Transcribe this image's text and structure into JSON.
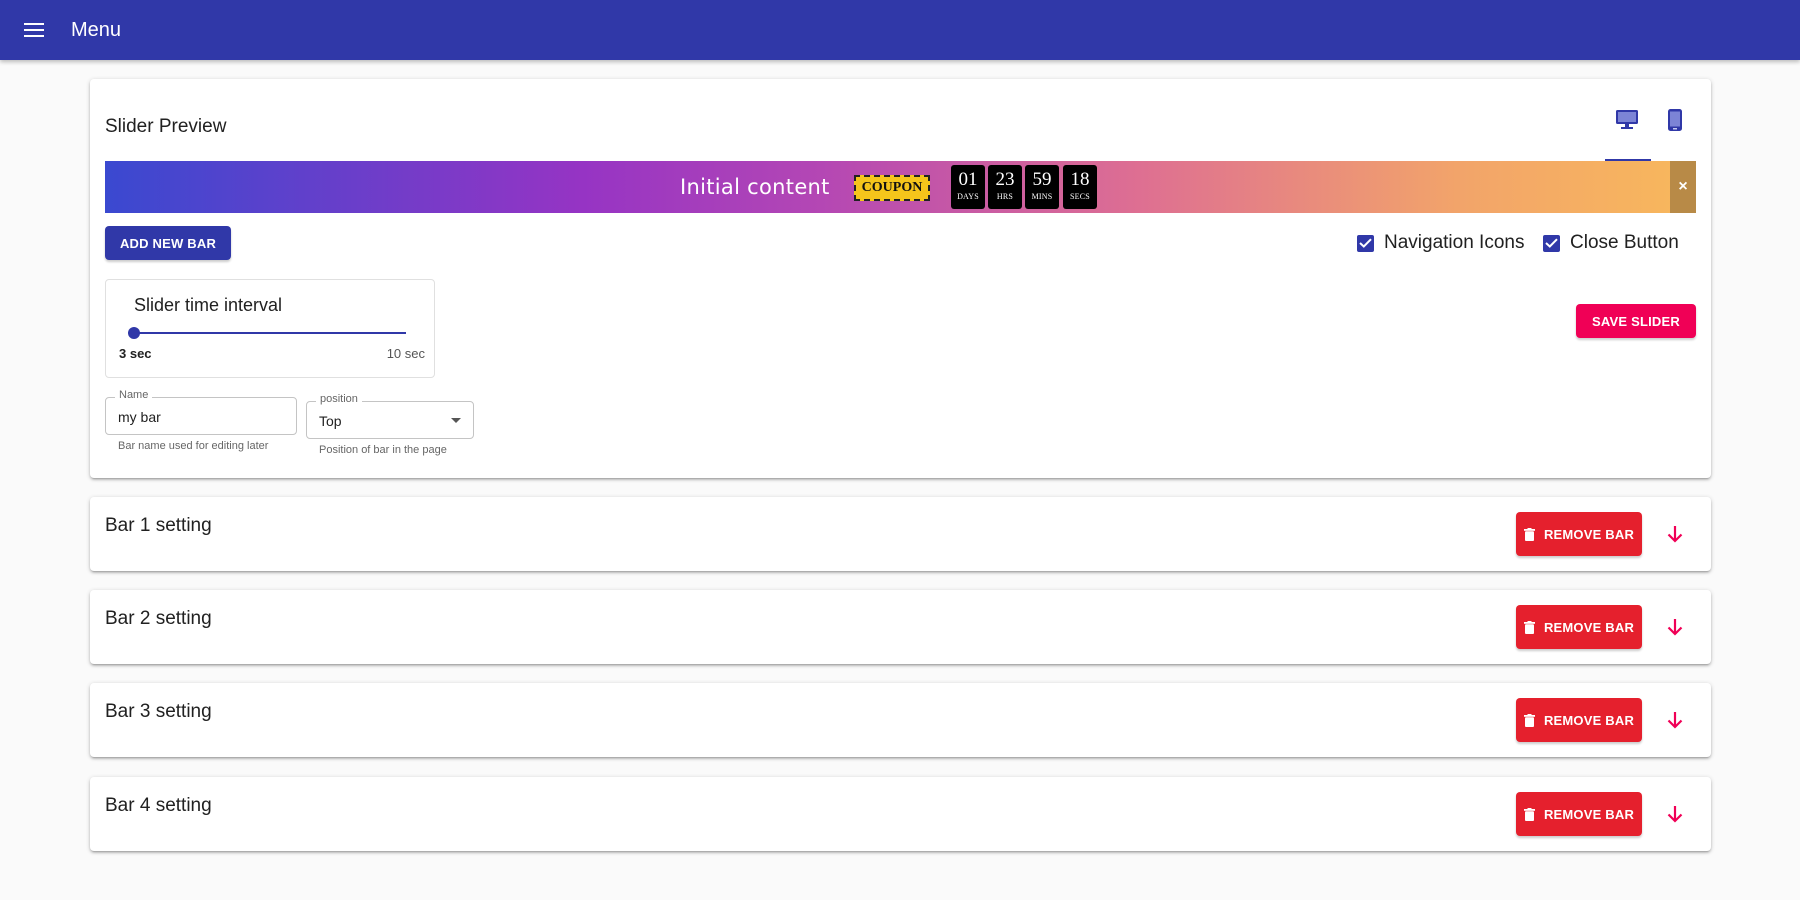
{
  "appbar": {
    "title": "Menu",
    "menu_icon": "hamburger-menu-icon",
    "background": "#3038a8"
  },
  "preview": {
    "title": "Slider Preview",
    "device_tabs": [
      {
        "name": "desktop",
        "icon": "desktop-monitor-icon",
        "selected": true
      },
      {
        "name": "mobile",
        "icon": "mobile-phone-icon",
        "selected": false
      }
    ],
    "promo_bar": {
      "text": "Initial content",
      "coupon_label": "COUPON",
      "countdown": [
        {
          "value": "01",
          "label": "DAYS"
        },
        {
          "value": "23",
          "label": "HRS"
        },
        {
          "value": "59",
          "label": "MINS"
        },
        {
          "value": "18",
          "label": "SECS"
        }
      ],
      "close_glyph": "×"
    },
    "add_button_label": "ADD NEW BAR",
    "options": {
      "navigation_icons": {
        "label": "Navigation Icons",
        "checked": true
      },
      "close_button": {
        "label": "Close Button",
        "checked": true
      }
    },
    "save_button_label": "SAVE SLIDER",
    "interval": {
      "title": "Slider time interval",
      "min_label": "3 sec",
      "max_label": "10 sec",
      "value_fraction": 0
    },
    "name_field": {
      "label": "Name",
      "value": "my bar",
      "helper": "Bar name used for editing later"
    },
    "position_field": {
      "label": "position",
      "value": "Top",
      "helper": "Position of bar in the page"
    }
  },
  "bars": [
    {
      "title": "Bar 1 setting",
      "remove_label": "REMOVE BAR"
    },
    {
      "title": "Bar 2 setting",
      "remove_label": "REMOVE BAR"
    },
    {
      "title": "Bar 3 setting",
      "remove_label": "REMOVE BAR"
    },
    {
      "title": "Bar 4 setting",
      "remove_label": "REMOVE BAR"
    }
  ],
  "colors": {
    "primary": "#3038a8",
    "secondary": "#f00056",
    "danger": "#e5202d",
    "coupon": "#f5c51b"
  }
}
